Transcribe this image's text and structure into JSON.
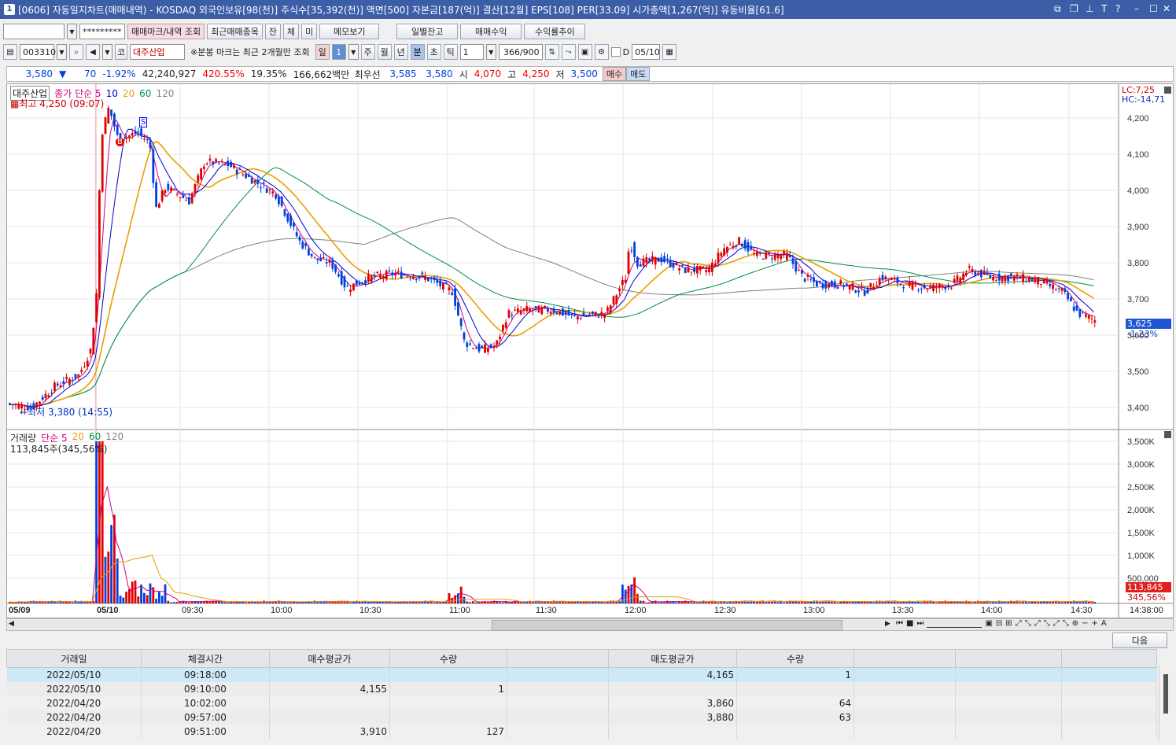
{
  "window": {
    "title": "[0606] 자동일지차트(매매내역) - KOSDAQ 외국인보유[98(천)] 주식수[35,392(천)] 액면[500] 자본금[187(억)] 결산[12월] EPS[108] PER[33.09] 시가총액[1,267(억)] 유동비율[61.6]",
    "icon_label": "1"
  },
  "toolbar1": {
    "account_value": "",
    "password_mask": "*********",
    "btn_mark": "매매마크/내역 조회",
    "btn_recent": "최근매매종목",
    "btn_jan": "잔",
    "btn_che": "체",
    "btn_mi": "미",
    "btn_memo": "메모보기",
    "btn_daily": "일별잔고",
    "btn_profit": "매매수익",
    "btn_rate": "수익률추이"
  },
  "toolbar2": {
    "code": "003310",
    "market_label": "코",
    "stock_name": "대주산업",
    "notice": "※분봉 마크는 최근 2개월만 조회",
    "period_il": "일",
    "period_value": "1",
    "period_ju": "주",
    "period_wol": "월",
    "period_nyeon": "년",
    "period_bun": "분",
    "period_cho": "초",
    "period_tik": "틱",
    "interval_value": "1",
    "count": "366/900",
    "d_label": "D",
    "date": "05/10"
  },
  "quote": {
    "price": "3,580",
    "arrow": "▼",
    "change": "70",
    "rate": "-1.92%",
    "volume": "42,240,927",
    "vol_rate": "420.55%",
    "turnover": "19.35%",
    "amount": "166,662백만",
    "best_label": "최우선",
    "ask": "3,585",
    "bid": "3,580",
    "open_label": "시",
    "open": "4,070",
    "high_label": "고",
    "high": "4,250",
    "low_label": "저",
    "low": "3,500",
    "buy": "매수",
    "sell": "매도"
  },
  "chart": {
    "legend_name": "대주산업",
    "legend_ma": "종가 단순 5",
    "ma10": "10",
    "ma20": "20",
    "ma60": "60",
    "ma120": "120",
    "high_note": "최고 4,250 (09:07)",
    "low_note": "←최저 3,380 (14:55)",
    "lc": "LC:7,25",
    "hc": "HC:-14,71",
    "price_ticks": [
      "4,200",
      "4,100",
      "4,000",
      "3,900",
      "3,800",
      "3,700",
      "3,600",
      "3,500",
      "3,400"
    ],
    "cur_price": "3,625",
    "cur_rate": "-1.23%",
    "vol_legend": "거래량",
    "vol_ma": "단순 5",
    "vol_info": "113,845주(345,56%)",
    "vol_ticks": [
      "3,500K",
      "3,000K",
      "2,500K",
      "2,000K",
      "1,500K",
      "1,000K",
      "500,000"
    ],
    "cur_vol": "113,845",
    "cur_vol_rate": "345,56%",
    "time_labels": [
      "05/09",
      "05/10",
      "09:30",
      "10:00",
      "10:30",
      "11:00",
      "11:30",
      "12:00",
      "12:30",
      "13:00",
      "13:30",
      "14:00",
      "14:30",
      "14:38:00"
    ],
    "mark_b": "B",
    "mark_s": "S"
  },
  "bottom": {
    "next_btn": "다음"
  },
  "table": {
    "headers": [
      "거래일",
      "체결시간",
      "매수평균가",
      "수량",
      "",
      "매도평균가",
      "수량",
      "",
      "",
      ""
    ],
    "rows": [
      [
        "2022/05/10",
        "09:18:00",
        "",
        "",
        "",
        "4,165",
        "1",
        "",
        "",
        ""
      ],
      [
        "2022/05/10",
        "09:10:00",
        "4,155",
        "1",
        "",
        "",
        "",
        "",
        "",
        ""
      ],
      [
        "2022/04/20",
        "10:02:00",
        "",
        "",
        "",
        "3,860",
        "64",
        "",
        "",
        ""
      ],
      [
        "2022/04/20",
        "09:57:00",
        "",
        "",
        "",
        "3,880",
        "63",
        "",
        "",
        ""
      ],
      [
        "2022/04/20",
        "09:51:00",
        "3,910",
        "127",
        "",
        "",
        "",
        "",
        "",
        ""
      ]
    ]
  },
  "colors": {
    "up": "#e00000",
    "down": "#0040e0",
    "ma5": "#d0007c",
    "ma10": "#0000cc",
    "ma20": "#e8a000",
    "ma60": "#008f3c",
    "ma120": "#808080",
    "title": "#3b5ea7"
  }
}
